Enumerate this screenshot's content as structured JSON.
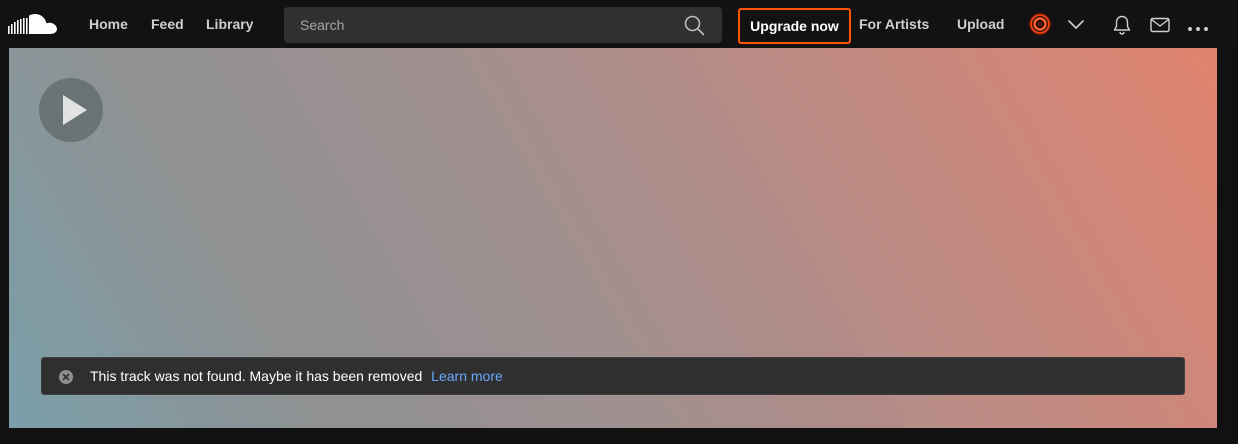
{
  "header": {
    "logo_icon": "soundcloud-logo-icon",
    "nav": {
      "home": "Home",
      "feed": "Feed",
      "library": "Library"
    },
    "search": {
      "placeholder": "Search",
      "icon": "search-icon"
    },
    "upgrade_label": "Upgrade now",
    "for_artists_label": "For Artists",
    "upload_label": "Upload",
    "icons": {
      "avatar": "avatar",
      "account_menu": "chevron-down-icon",
      "notifications": "bell-icon",
      "messages": "mail-icon",
      "more": "more-icon"
    }
  },
  "hero": {
    "play_icon": "play-icon"
  },
  "notice": {
    "close_icon": "close-icon",
    "message": "This track was not found. Maybe it has been removed",
    "link": "Learn more"
  },
  "colors": {
    "accent": "#ff5500",
    "topbar": "#121212",
    "search_bg": "#303030",
    "notice_bg": "#2f2f2f",
    "link": "#6aa8ff"
  }
}
